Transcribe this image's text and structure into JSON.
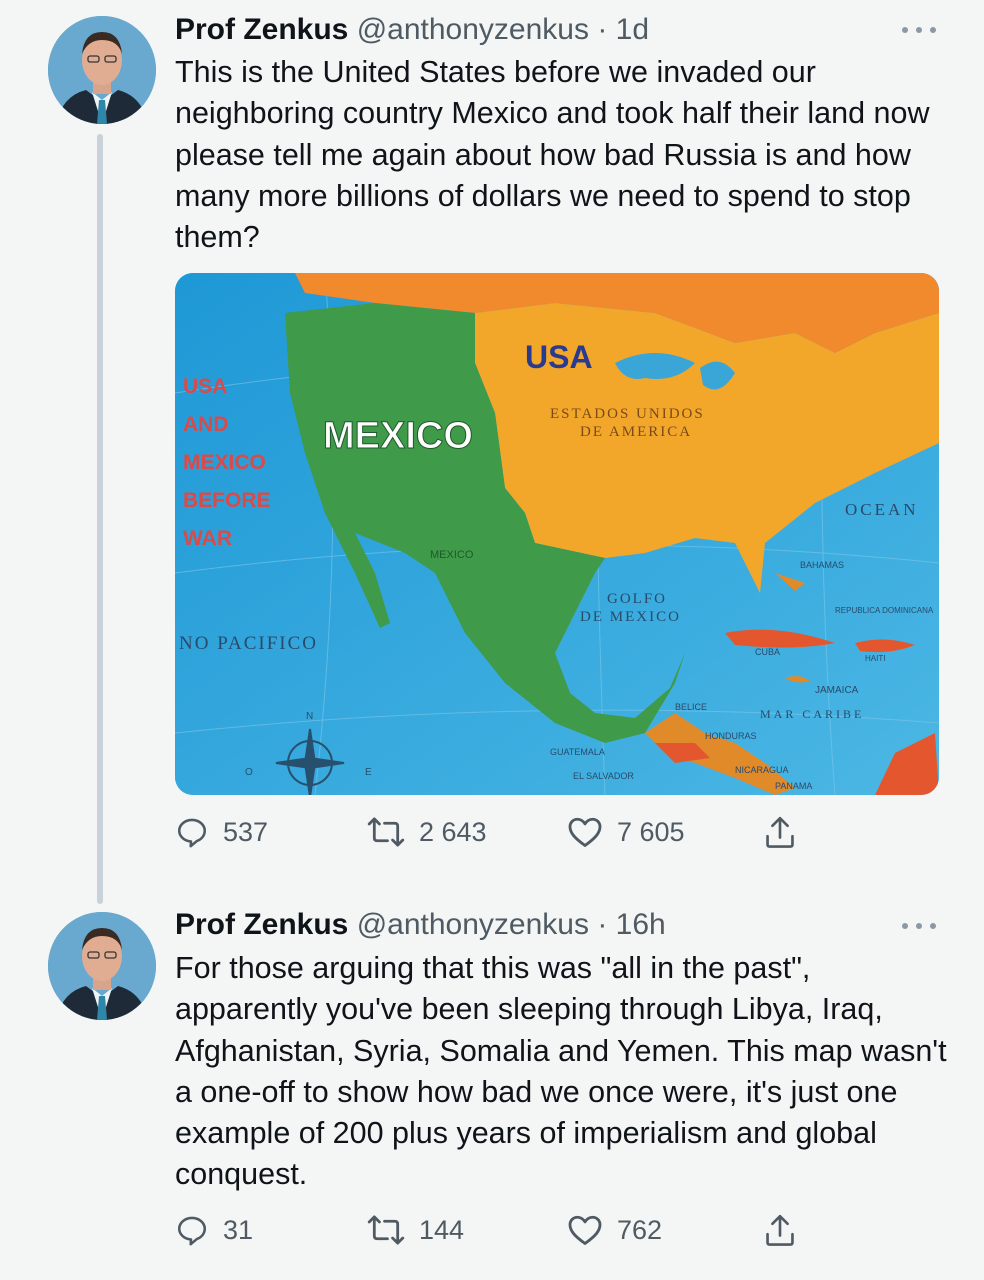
{
  "thread": [
    {
      "author": {
        "name": "Prof Zenkus",
        "handle": "@anthonyzenkus",
        "separator": "·"
      },
      "time": "1d",
      "text": "This is the United States before we invaded our neighboring country Mexico and took half their land now please tell me again about how bad Russia is and how many more billions of dollars we need to spend to stop them?",
      "media": {
        "labels": {
          "usa": "USA",
          "estados_1": "ESTADOS UNIDOS",
          "estados_2": "DE AMERICA",
          "mexico": "MEXICO",
          "before_1": "USA",
          "before_2": "AND",
          "before_3": "MEXICO",
          "before_4": "BEFORE",
          "before_5": "WAR",
          "pacifico": "NO PACIFICO",
          "golfo_1": "GOLFO",
          "golfo_2": "DE MEXICO",
          "oceano": "OCEAN",
          "cuba": "CUBA",
          "bahamas": "BAHAMAS",
          "jamaica": "JAMAICA",
          "caribe": "MAR CARIBE",
          "mexico_small": "MEXICO",
          "belice": "BELICE",
          "honduras": "HONDURAS",
          "guatemala": "GUATEMALA",
          "salvador": "EL SALVADOR",
          "nicaragua": "NICARAGUA",
          "panama": "PANAMA",
          "republica": "REPUBLICA DOMINICANA",
          "haiti": "HAITI",
          "compass_n": "N",
          "compass_o": "O",
          "compass_e": "E"
        }
      },
      "stats": {
        "replies": "537",
        "retweets": "2 643",
        "likes": "7 605"
      }
    },
    {
      "author": {
        "name": "Prof Zenkus",
        "handle": "@anthonyzenkus",
        "separator": "·"
      },
      "time": "16h",
      "text": "For those arguing that this was \"all in the past\", apparently you've been sleeping through Libya, Iraq, Afghanistan, Syria, Somalia and Yemen. This map wasn't a one-off to show how bad we once were, it's just one example of 200 plus years of imperialism and global conquest.",
      "stats": {
        "replies": "31",
        "retweets": "144",
        "likes": "762"
      }
    }
  ],
  "icons": [
    "reply-icon",
    "retweet-icon",
    "like-icon",
    "share-icon",
    "more-icon"
  ],
  "colors": {
    "text": "#0f1419",
    "secondary": "#4f5a63",
    "background": "#f4f6f6",
    "usa": "#f0a629",
    "mexico": "#3f9a4a",
    "ocean": "#3aa6d8"
  }
}
